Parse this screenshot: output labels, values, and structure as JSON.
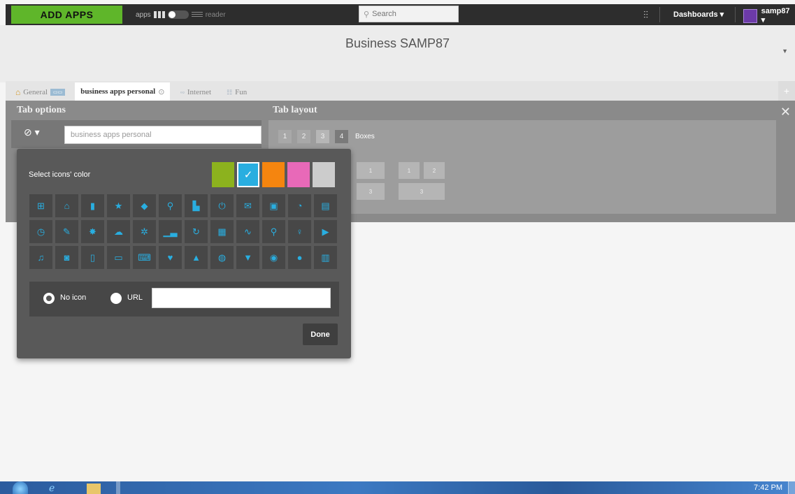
{
  "topbar": {
    "add_apps": "ADD APPS",
    "apps_label": "apps",
    "reader_label": "reader",
    "search_placeholder": "Search",
    "dashboards_label": "Dashboards ▾",
    "username": "samp87 ▾"
  },
  "dashboard": {
    "title": "Business SAMP87"
  },
  "tabs": [
    {
      "label": "General",
      "icon": "home-icon"
    },
    {
      "label": "business apps personal",
      "icon": "options-icon",
      "active": true
    },
    {
      "label": "Internet",
      "icon": "dot-icon"
    },
    {
      "label": "Fun",
      "icon": "grid-icon"
    }
  ],
  "tab_options": {
    "title": "Tab options",
    "name_value": "business apps personal",
    "icon_selector": "⊘ ▾"
  },
  "tab_layout": {
    "title": "Tab layout",
    "columns": [
      "1",
      "2",
      "3",
      "4"
    ],
    "boxes_label": "Boxes",
    "thumb_labels": [
      "1",
      "3",
      "1",
      "2",
      "3"
    ]
  },
  "icon_picker": {
    "color_label": "Select icons' color",
    "colors": [
      {
        "name": "green",
        "hex": "#8cb21e"
      },
      {
        "name": "blue",
        "hex": "#29aee0",
        "selected": true
      },
      {
        "name": "orange",
        "hex": "#f5850f"
      },
      {
        "name": "pink",
        "hex": "#e869b8"
      },
      {
        "name": "grey",
        "hex": "#cccccc"
      }
    ],
    "selected_mark": "✓",
    "icons": [
      [
        "plus-square-icon",
        "home-icon",
        "bookmark-icon",
        "star-icon",
        "tag-icon",
        "location-pin-icon",
        "document-icon",
        "power-icon",
        "mail-icon",
        "notepad-icon",
        "rss-icon",
        "calculator-icon"
      ],
      [
        "clock-icon",
        "pencil-icon",
        "bug-icon",
        "cloud-icon",
        "gear-icon",
        "bar-chart-icon",
        "refresh-icon",
        "table-icon",
        "line-chart-icon",
        "search-icon",
        "lightbulb-icon",
        "video-icon"
      ],
      [
        "music-icon",
        "camera-icon",
        "tablet-icon",
        "monitor-icon",
        "laptop-icon",
        "heart-icon",
        "warning-icon",
        "globe-icon",
        "filter-icon",
        "eye-icon",
        "chat-bubble-icon",
        "calendar-icon",
        "checkmark-icon"
      ]
    ],
    "no_icon_label": "No icon",
    "url_label": "URL",
    "url_value": "",
    "done_label": "Done"
  },
  "taskbar": {
    "clock": "7:42 PM"
  }
}
